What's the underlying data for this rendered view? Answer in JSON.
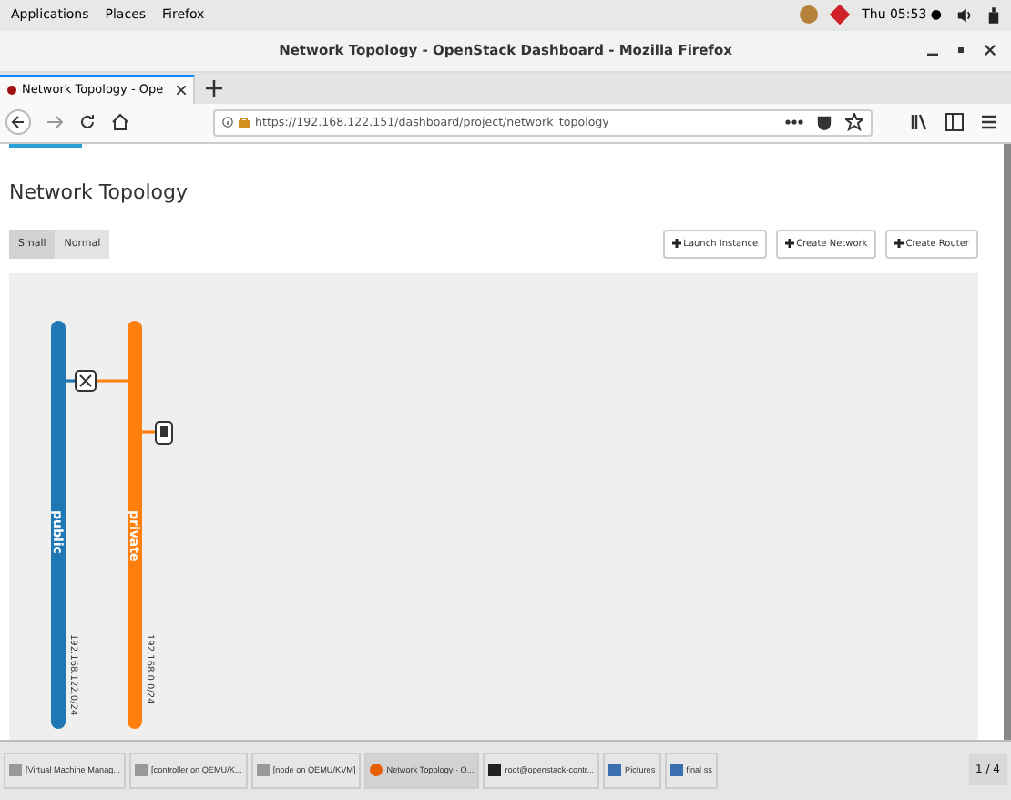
{
  "top_bar": {
    "menus": [
      "Applications",
      "Places",
      "Firefox"
    ],
    "clock": "Thu 05:53 ●"
  },
  "window": {
    "title": "Network Topology - OpenStack Dashboard - Mozilla Firefox"
  },
  "tabs": [
    {
      "label": "Network Topology - Ope",
      "selected": true
    }
  ],
  "address_bar": {
    "url": "https://192.168.122.151/dashboard/project/network_topology"
  },
  "page": {
    "heading": "Network Topology",
    "size_toggle": [
      {
        "label": "Small",
        "selected": true
      },
      {
        "label": "Normal",
        "selected": false
      }
    ],
    "actions": [
      "Launch Instance",
      "Create Network",
      "Create Router"
    ]
  },
  "topology": {
    "networks": [
      {
        "name": "public",
        "cidr": "192.168.122.0/24",
        "color": "#1f77b4"
      },
      {
        "name": "private",
        "cidr": "192.168.0.0/24",
        "color": "#ff7f0e"
      }
    ]
  },
  "taskbar": {
    "items": [
      {
        "label": "[Virtual Machine Manag...",
        "kind": "window",
        "selected": false
      },
      {
        "label": "[controller on QEMU/K...",
        "kind": "window",
        "selected": false
      },
      {
        "label": "[node on QEMU/KVM]",
        "kind": "window",
        "selected": false
      },
      {
        "label": "Network Topology · O...",
        "kind": "browser",
        "selected": true
      },
      {
        "label": "root@openstack-contr...",
        "kind": "terminal",
        "selected": false
      },
      {
        "label": "Pictures",
        "kind": "folder",
        "selected": false
      },
      {
        "label": "final ss",
        "kind": "folder",
        "selected": false
      }
    ],
    "workspace": "1 / 4"
  }
}
